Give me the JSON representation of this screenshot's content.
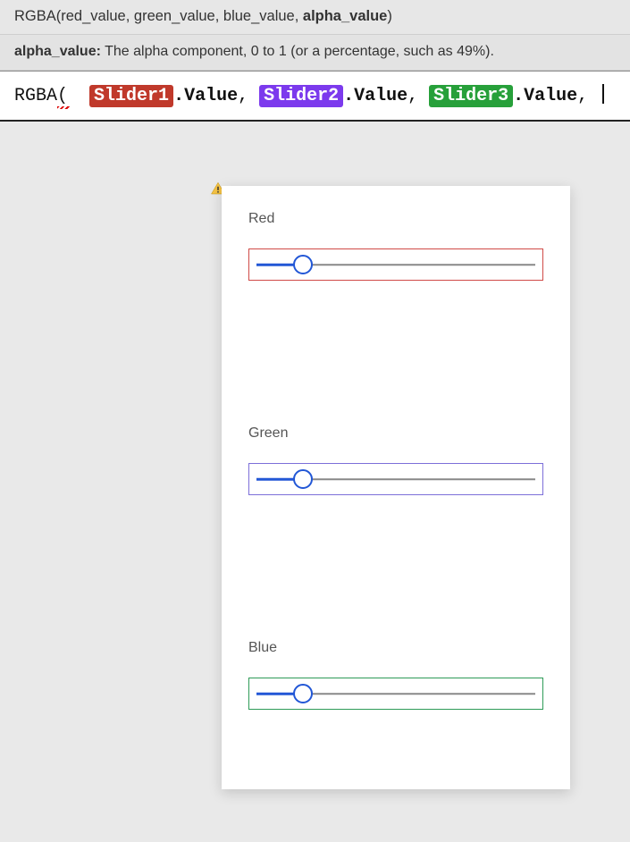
{
  "tooltip": {
    "signature": {
      "fn": "RGBA",
      "params_prefix": "red_value, green_value, blue_value, ",
      "active_param": "alpha_value"
    },
    "description": {
      "param_label": "alpha_value:",
      "text": " The alpha component, 0 to 1 (or a percentage, such as 49%)."
    }
  },
  "formula": {
    "fn": "RGBA",
    "paren_open": "(",
    "args": [
      {
        "chip": "Slider1",
        "chip_color": "red",
        "prop": ".Value"
      },
      {
        "chip": "Slider2",
        "chip_color": "purple",
        "prop": ".Value"
      },
      {
        "chip": "Slider3",
        "chip_color": "green",
        "prop": ".Value"
      }
    ],
    "separator": ", ",
    "trailing": ", "
  },
  "sliders": [
    {
      "label": "Red",
      "border_class": "sel-red",
      "value_percent": 16
    },
    {
      "label": "Green",
      "border_class": "sel-purple",
      "value_percent": 16
    },
    {
      "label": "Blue",
      "border_class": "sel-green",
      "value_percent": 16
    }
  ],
  "warning_icon": "warning"
}
